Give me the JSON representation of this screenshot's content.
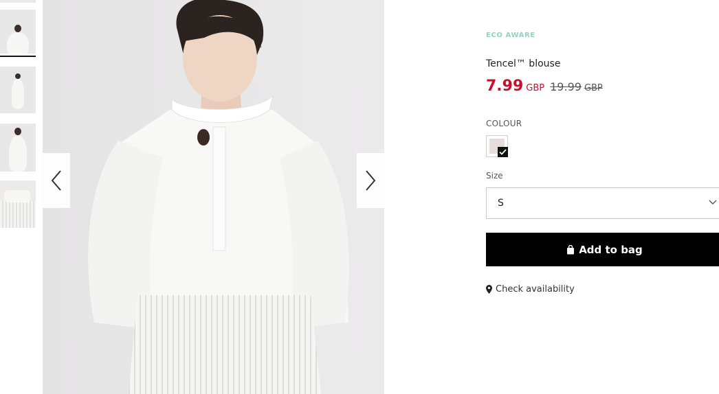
{
  "product": {
    "badge": "ECO AWARE",
    "title": "Tencel™ blouse",
    "price_current": "7.99",
    "price_current_currency": "GBP",
    "price_original": "19.99",
    "price_original_currency": "GBP"
  },
  "colour": {
    "label": "COLOUR",
    "selected_swatch": "#e4dddc"
  },
  "size": {
    "label": "Size",
    "selected": "S"
  },
  "actions": {
    "add_to_bag": "Add to bag",
    "check_availability": "Check availability"
  },
  "gallery": {
    "thumbnail_count": 4,
    "active_thumbnail": 1,
    "prev_icon": "chevron-left-icon",
    "next_icon": "chevron-right-icon"
  },
  "colors": {
    "sale_price": "#c8102e",
    "eco_badge": "#8fd3c2",
    "button_bg": "#000000"
  }
}
